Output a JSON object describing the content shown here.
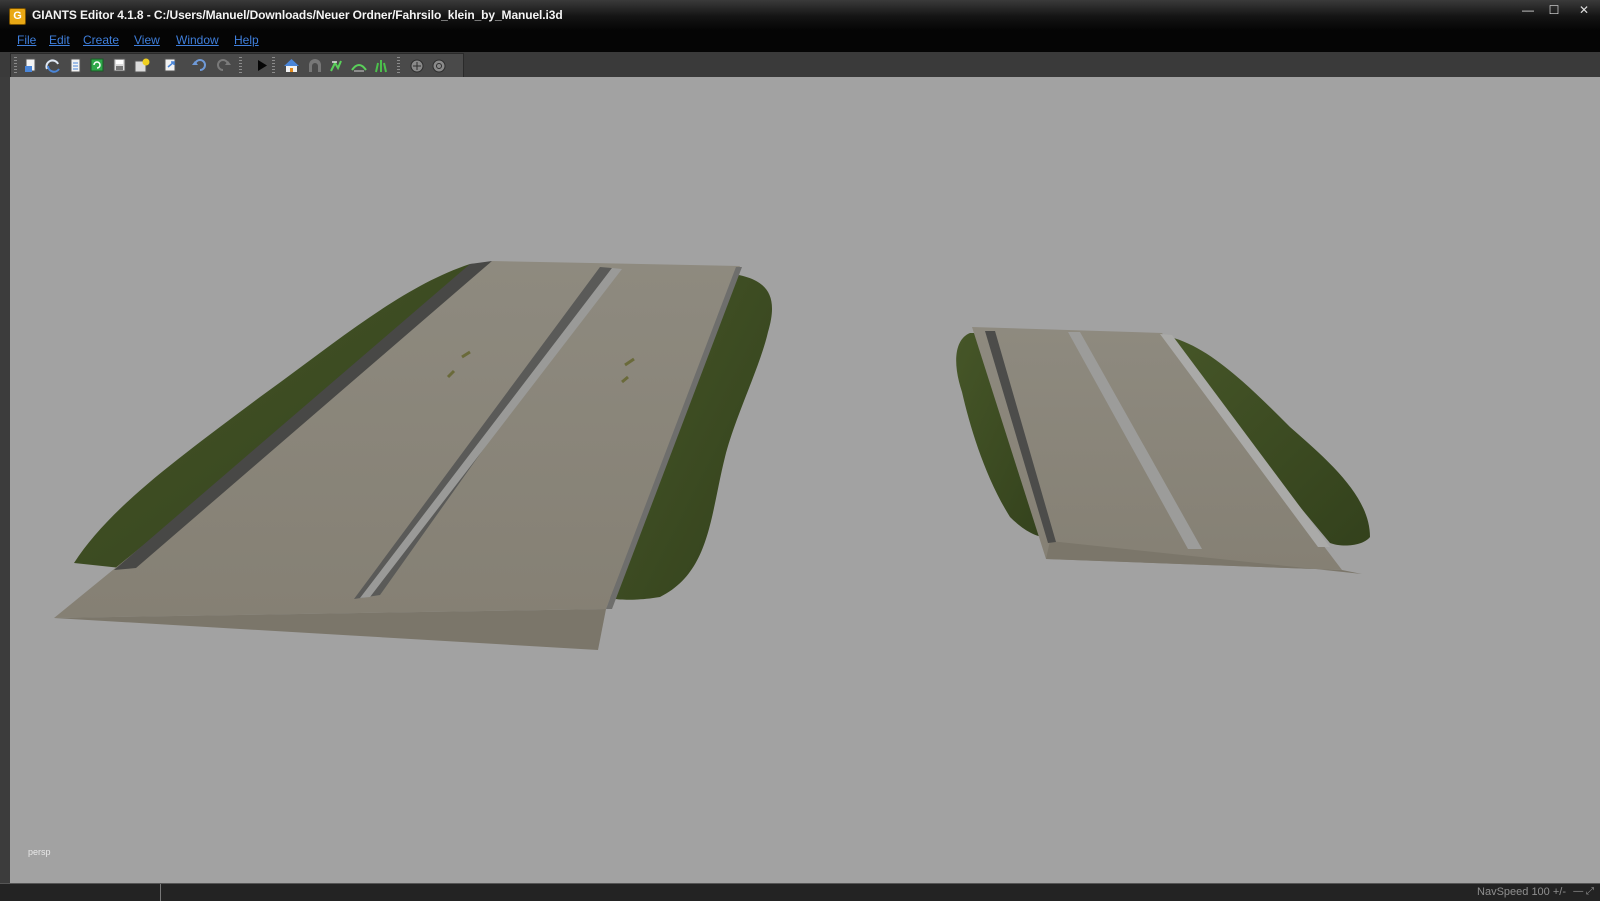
{
  "window": {
    "title": "GIANTS Editor 4.1.8 - C:/Users/Manuel/Downloads/Neuer Ordner/Fahrsilo_klein_by_Manuel.i3d",
    "app_icon_letter": "G",
    "minimize_glyph": "—",
    "maximize_glyph": "☐",
    "close_glyph": "✕"
  },
  "menu": [
    "File",
    "Edit",
    "Create",
    "View",
    "Window",
    "Help"
  ],
  "toolbar": {
    "icons": [
      "new-file-icon",
      "open-file-icon",
      "document-icon",
      "reload-icon",
      "save-icon",
      "save-as-icon",
      "export-icon",
      "undo-icon",
      "redo-icon",
      "play-icon",
      "home-icon",
      "arch-icon",
      "terrain-paint-icon",
      "terrain-smooth-icon",
      "foliage-paint-icon",
      "gizmo-translate-icon",
      "gizmo-rotate-icon"
    ]
  },
  "viewport": {
    "camera_label": "persp",
    "background_color": "#a2a2a2"
  },
  "status": {
    "navspeed": "NavSpeed 100 +/-",
    "corner": "—  ⤢"
  },
  "colors": {
    "titlebar": "#141414",
    "menu_text": "#3f7fdc",
    "toolbar": "#3a3a3a",
    "grass": "#3c4a22",
    "concrete": "#88847a",
    "wall": "#4a4a48"
  }
}
